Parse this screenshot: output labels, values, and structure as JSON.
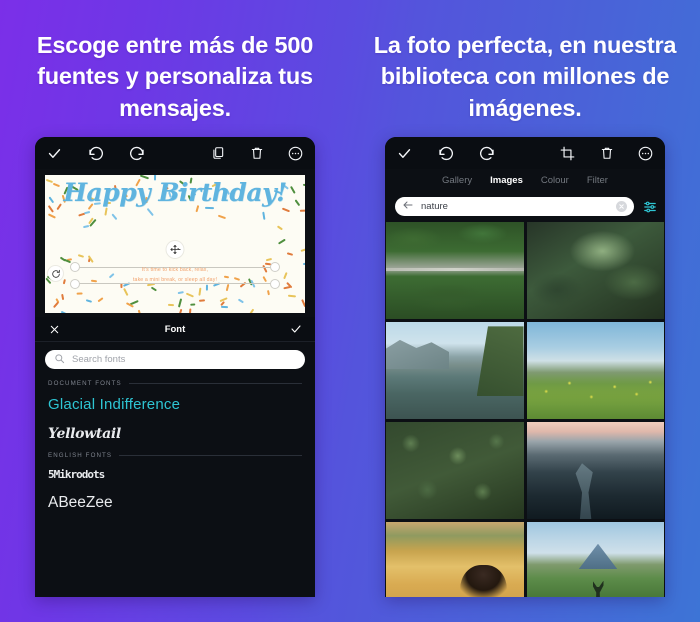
{
  "theme": {
    "gradient_start": "#7B2FE8",
    "gradient_mid": "#5454DC",
    "gradient_end": "#3D74D6",
    "accent_teal": "#2EC5D3",
    "panel_bg": "#0C0F14"
  },
  "panels": [
    {
      "headline": "Escoge entre más de 500 fuentes y personaliza tus mensajes."
    },
    {
      "headline": "La foto perfecta, en nuestra biblioteca con millones de imágenes."
    }
  ],
  "left_phone": {
    "toolbar": {
      "left_icons": [
        {
          "name": "confirm-icon",
          "label": "check"
        },
        {
          "name": "undo-icon",
          "label": "undo"
        },
        {
          "name": "redo-icon",
          "label": "redo"
        }
      ],
      "right_icons": [
        {
          "name": "duplicate-icon",
          "label": "duplicate"
        },
        {
          "name": "delete-icon",
          "label": "delete"
        },
        {
          "name": "more-options-icon",
          "label": "more"
        }
      ]
    },
    "canvas": {
      "title": "Happy Birthday!",
      "subtitle_line1": "It's time to kick back, relax,",
      "subtitle_line2": "take a mini break, or sleep all day!",
      "title_color": "#5FB4DF",
      "subtitle_color": "#F1A06A",
      "background": "#FDFCF4"
    },
    "panel": {
      "close_icon": "close-icon",
      "title": "Font",
      "confirm_icon": "check-icon",
      "search": {
        "icon": "search-icon",
        "placeholder": "Search fonts",
        "value": ""
      },
      "sections": [
        {
          "label": "DOCUMENT FONTS",
          "fonts": [
            {
              "name": "Glacial Indifference",
              "selected": true
            },
            {
              "name": "Yellowtail",
              "selected": false
            }
          ]
        },
        {
          "label": "ENGLISH FONTS",
          "fonts": [
            {
              "name": "5Mikrodots",
              "selected": false
            },
            {
              "name": "ABeeZee",
              "selected": false
            }
          ]
        }
      ]
    }
  },
  "right_phone": {
    "toolbar": {
      "left_icons": [
        {
          "name": "confirm-icon",
          "label": "check"
        },
        {
          "name": "undo-icon",
          "label": "undo"
        },
        {
          "name": "redo-icon",
          "label": "redo"
        }
      ],
      "right_icons": [
        {
          "name": "crop-icon",
          "label": "crop"
        },
        {
          "name": "delete-icon",
          "label": "delete"
        },
        {
          "name": "more-options-icon",
          "label": "more"
        }
      ]
    },
    "tabs": [
      {
        "label": "Gallery",
        "active": false
      },
      {
        "label": "Images",
        "active": true
      },
      {
        "label": "Colour",
        "active": false
      },
      {
        "label": "Filter",
        "active": false
      }
    ],
    "search": {
      "back_icon": "back-arrow-icon",
      "value": "nature",
      "clear_icon": "clear-icon",
      "filter_icon": "sliders-filter-icon"
    },
    "grid": [
      {
        "alt": "aerial view of road through green forest"
      },
      {
        "alt": "dark green leaves with water droplets"
      },
      {
        "alt": "person sitting on wooden dock by mountain lake"
      },
      {
        "alt": "yellow wildflowers field under cloudy sky"
      },
      {
        "alt": "dense green clover ground cover"
      },
      {
        "alt": "misty river valley aerial at dawn"
      },
      {
        "alt": "woman facing autumn golden field and forest"
      },
      {
        "alt": "person standing with arms out before a volcano"
      }
    ]
  }
}
